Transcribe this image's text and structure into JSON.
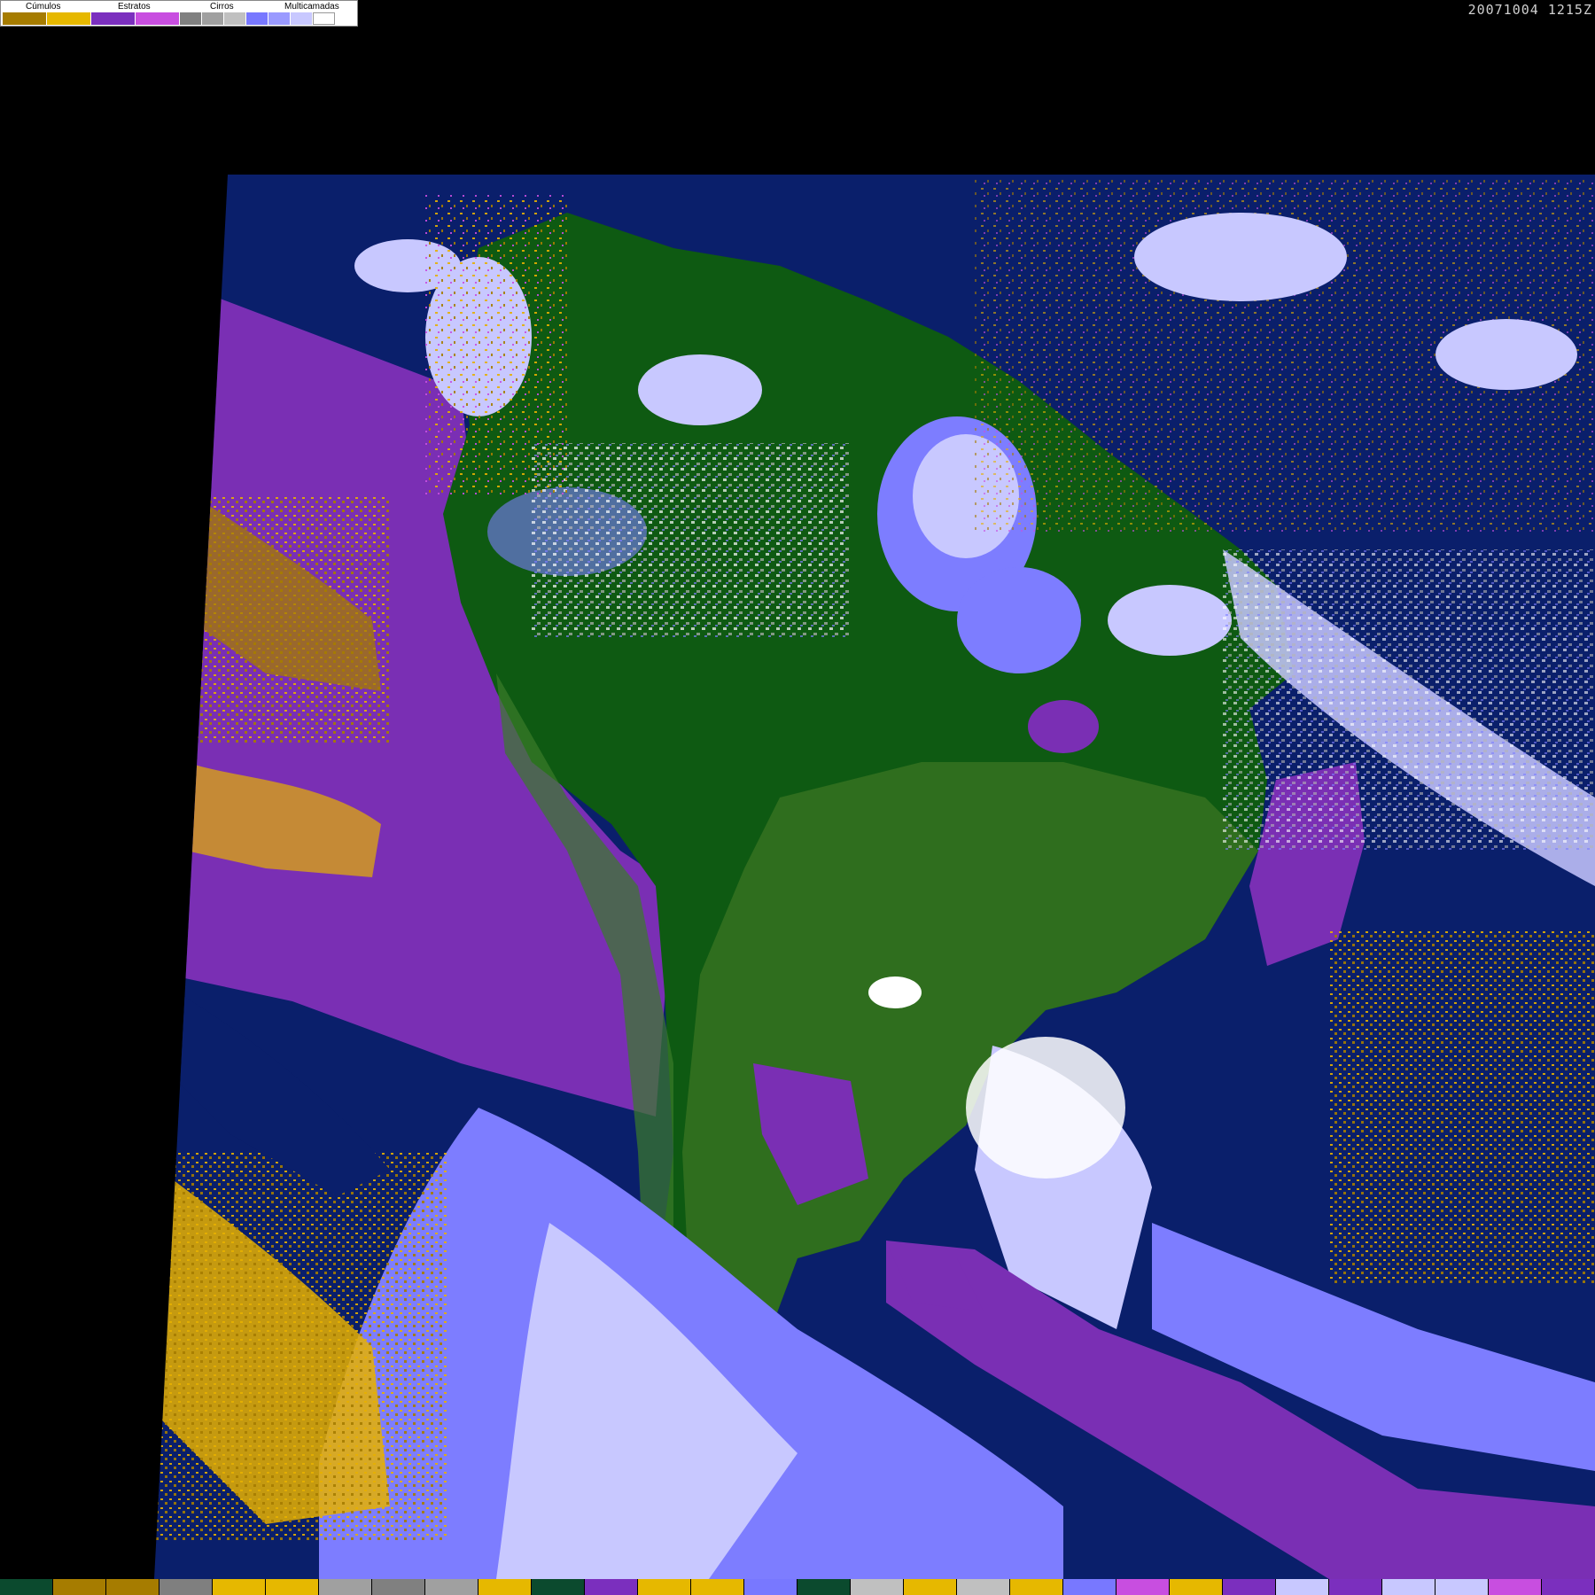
{
  "timestamp": "20071004 1215Z",
  "legend": {
    "categories": [
      {
        "label": "Cúmulos",
        "swatches": [
          "#a67c00",
          "#e6b800"
        ]
      },
      {
        "label": "Estratos",
        "swatches": [
          "#7b2fbe",
          "#c84ee0"
        ]
      },
      {
        "label": "Cirros",
        "swatches": [
          "#808080",
          "#a0a0a0",
          "#c0c0c0"
        ]
      },
      {
        "label": "Multicamadas",
        "swatches": [
          "#7878ff",
          "#9a9aff",
          "#c8c8ff",
          "#ffffff"
        ]
      }
    ]
  },
  "colors": {
    "ocean": "#0a1f6b",
    "land_dark": "#0e5a12",
    "land": "#2f6e1e",
    "stratus": "#7a2fb4",
    "cumulus_dark": "#a67c00",
    "cumulus": "#e6b000",
    "multilayer": "#7d7dff",
    "multilayer_light": "#c8c8ff",
    "cirrus": "#b5b5b5",
    "white": "#ffffff"
  },
  "bottom_strip": [
    "#0b4a2e",
    "#a67c00",
    "#a67c00",
    "#7f7f7f",
    "#e6b800",
    "#e6b800",
    "#a0a0a0",
    "#808080",
    "#a0a0a0",
    "#e6b800",
    "#0b4a2e",
    "#7b2fbe",
    "#e6b800",
    "#e6b800",
    "#7878ff",
    "#0b4a2e",
    "#c0c0c0",
    "#e6b800",
    "#c0c0c0",
    "#e6b800",
    "#7878ff",
    "#c84ee0",
    "#e6b800",
    "#7b2fbe",
    "#c8c8ff",
    "#7b2fbe",
    "#c8c8ff",
    "#c8c8ff",
    "#c84ee0",
    "#7b2fbe"
  ]
}
